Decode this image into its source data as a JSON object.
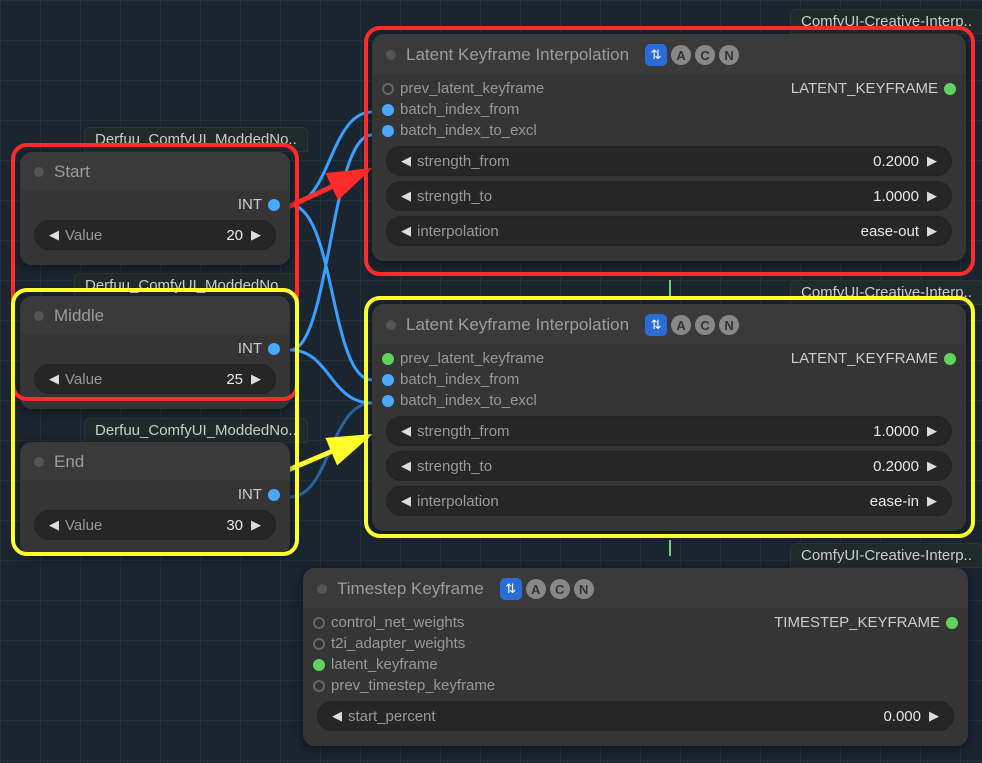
{
  "tags": {
    "derfuu1": "Derfuu_ComfyUI_ModdedNo..",
    "derfuu2": "Derfuu_ComfyUI_ModdedNo..",
    "derfuu3": "Derfuu_ComfyUI_ModdedNo..",
    "creative1": "ComfyUI-Creative-Interp..",
    "creative2": "ComfyUI-Creative-Interp..",
    "creative3": "ComfyUI-Creative-Interp.."
  },
  "start_node": {
    "title": "Start",
    "out_label": "INT",
    "value_label": "Value",
    "value": "20"
  },
  "middle_node": {
    "title": "Middle",
    "out_label": "INT",
    "value_label": "Value",
    "value": "25"
  },
  "end_node": {
    "title": "End",
    "out_label": "INT",
    "value_label": "Value",
    "value": "30"
  },
  "lki1": {
    "title": "Latent Keyframe Interpolation",
    "inputs": {
      "prev": "prev_latent_keyframe",
      "from": "batch_index_from",
      "to": "batch_index_to_excl"
    },
    "output": "LATENT_KEYFRAME",
    "strength_from_label": "strength_from",
    "strength_from": "0.2000",
    "strength_to_label": "strength_to",
    "strength_to": "1.0000",
    "interp_label": "interpolation",
    "interp": "ease-out"
  },
  "lki2": {
    "title": "Latent Keyframe Interpolation",
    "inputs": {
      "prev": "prev_latent_keyframe",
      "from": "batch_index_from",
      "to": "batch_index_to_excl"
    },
    "output": "LATENT_KEYFRAME",
    "strength_from_label": "strength_from",
    "strength_from": "1.0000",
    "strength_to_label": "strength_to",
    "strength_to": "0.2000",
    "interp_label": "interpolation",
    "interp": "ease-in"
  },
  "tk": {
    "title": "Timestep Keyframe",
    "inputs": {
      "cnw": "control_net_weights",
      "t2i": "t2i_adapter_weights",
      "lk": "latent_keyframe",
      "ptk": "prev_timestep_keyframe"
    },
    "output": "TIMESTEP_KEYFRAME",
    "start_percent_label": "start_percent",
    "start_percent": "0.000"
  }
}
